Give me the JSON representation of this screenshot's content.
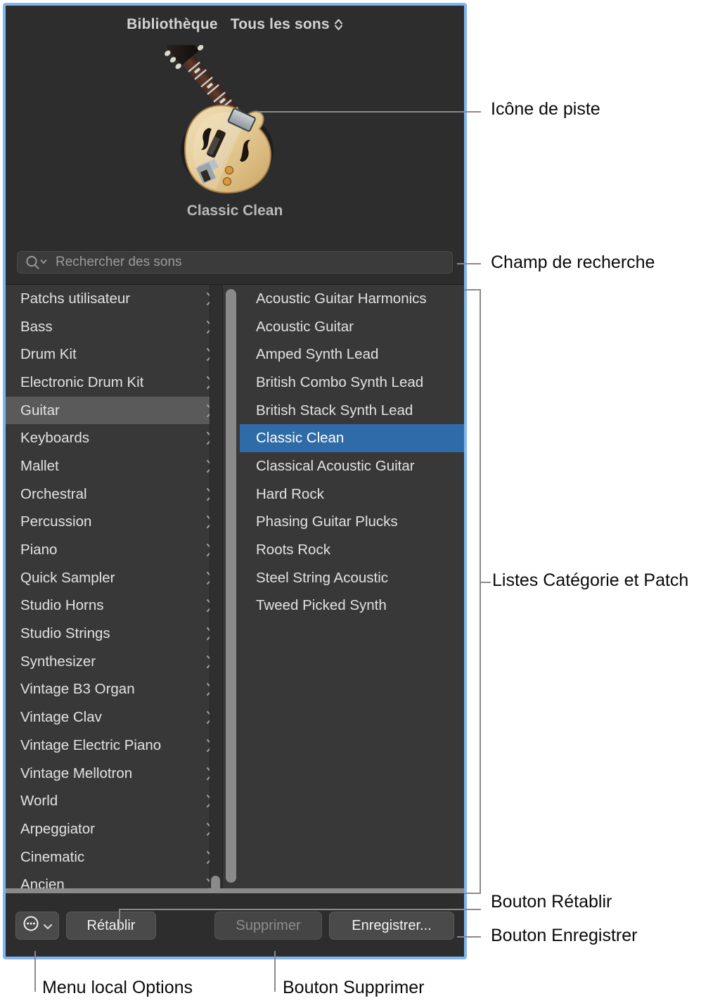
{
  "panel": {
    "header": {
      "library_label": "Bibliothèque",
      "filter_label": "Tous les sons",
      "stepper_icon": "up-down-chevron-icon"
    },
    "hero": {
      "track_icon": "electric-archtop-guitar-icon",
      "patch_title": "Classic Clean"
    },
    "search": {
      "icon": "search-icon",
      "placeholder": "Rechercher des sons"
    },
    "categories": [
      "Patchs utilisateur",
      "Bass",
      "Drum Kit",
      "Electronic Drum Kit",
      "Guitar",
      "Keyboards",
      "Mallet",
      "Orchestral",
      "Percussion",
      "Piano",
      "Quick Sampler",
      "Studio Horns",
      "Studio Strings",
      "Synthesizer",
      "Vintage B3 Organ",
      "Vintage Clav",
      "Vintage Electric Piano",
      "Vintage Mellotron",
      "World",
      "Arpeggiator",
      "Cinematic",
      "Ancien"
    ],
    "selected_category": "Guitar",
    "patches": [
      "Acoustic Guitar Harmonics",
      "Acoustic Guitar",
      "Amped Synth Lead",
      "British Combo Synth Lead",
      "British Stack Synth Lead",
      "Classic Clean",
      "Classical Acoustic Guitar",
      "Hard Rock",
      "Phasing Guitar Plucks",
      "Roots Rock",
      "Steel String Acoustic",
      "Tweed Picked Synth"
    ],
    "selected_patch": "Classic Clean",
    "footer": {
      "options_label": "",
      "options_icon": "ellipsis-circle-icon",
      "options_chevron_icon": "chevron-down-icon",
      "reset_label": "Rétablir",
      "delete_label": "Supprimer",
      "save_label": "Enregistrer..."
    },
    "colors": {
      "focus_ring": "#7fb5f2",
      "panel_background": "#2d2d2d",
      "list_background": "#383838",
      "category_selection": "#5a5a5a",
      "patch_selection": "#2f6ba6",
      "scrollbar": "#8a8a8a"
    }
  },
  "annotations": {
    "track_icon": "Icône de piste",
    "search_field": "Champ de recherche",
    "lists": "Listes Catégorie et Patch",
    "reset_button": "Bouton Rétablir",
    "save_button": "Bouton Enregistrer",
    "options_menu": "Menu local Options",
    "delete_button": "Bouton Supprimer"
  }
}
